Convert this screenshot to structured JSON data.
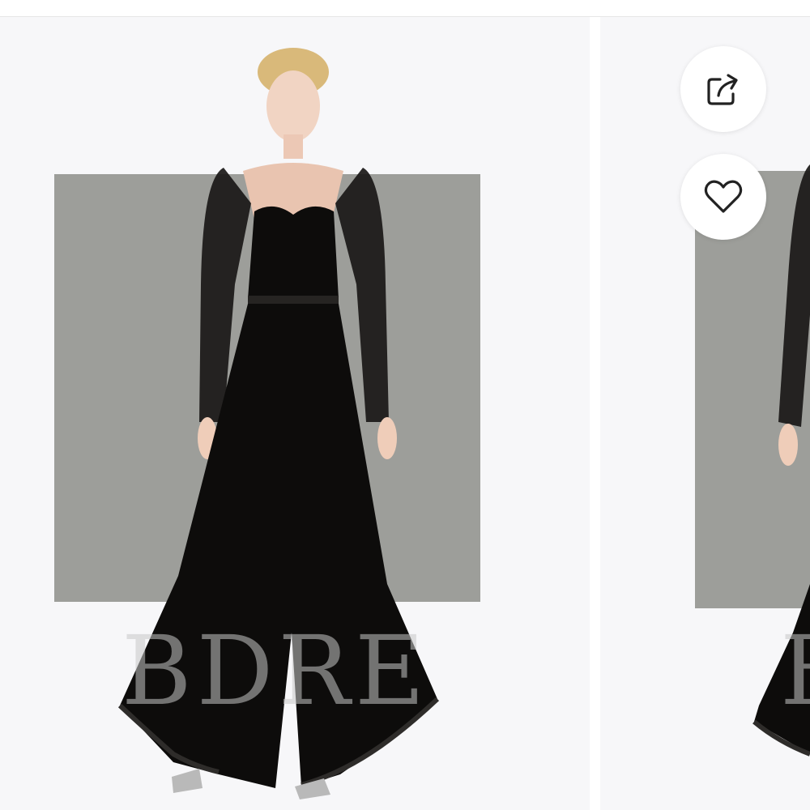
{
  "gallery": {
    "slides": [
      {
        "watermark_text": "BDRE"
      },
      {
        "watermark_text": "B"
      }
    ]
  },
  "actions": {
    "share_icon": "share-icon",
    "favorite_icon": "heart-icon"
  },
  "colors": {
    "backdrop": "#9d9e9a",
    "garment": "#0d0c0b",
    "background": "#f7f7f9"
  }
}
